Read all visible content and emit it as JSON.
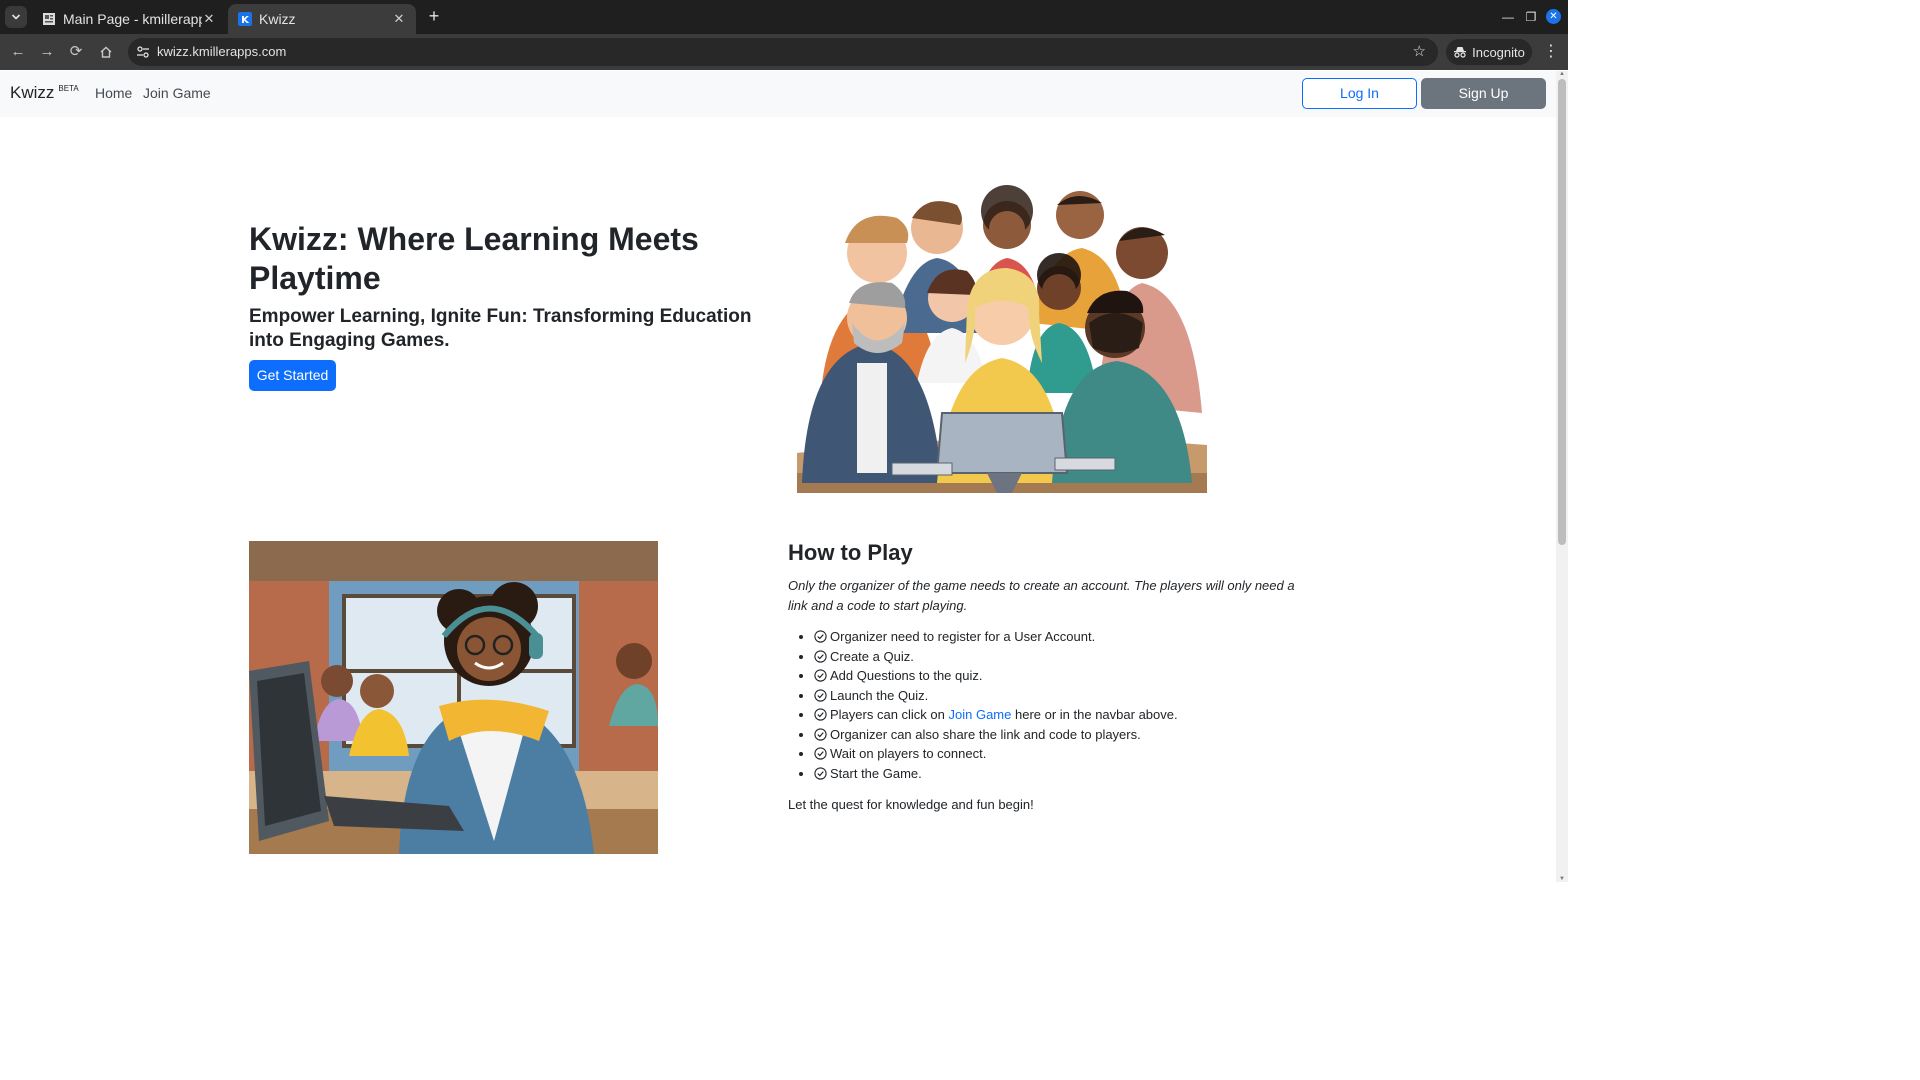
{
  "browser": {
    "tabs": [
      {
        "title": "Main Page - kmillerapps",
        "active": false
      },
      {
        "title": "Kwizz",
        "active": true
      }
    ],
    "url": "kwizz.kmillerapps.com",
    "incognito_label": "Incognito"
  },
  "navbar": {
    "brand": "Kwizz",
    "brand_badge": "BETA",
    "links": [
      "Home",
      "Join Game"
    ],
    "login_label": "Log In",
    "signup_label": "Sign Up"
  },
  "hero": {
    "title": "Kwizz: Where Learning Meets Playtime",
    "subtitle": "Empower Learning, Ignite Fun: Transforming Education into Engaging Games.",
    "cta_label": "Get Started"
  },
  "how_to": {
    "title": "How to Play",
    "intro": "Only the organizer of the game needs to create an account. The players will only need a link and a code to start playing.",
    "steps": [
      "Organizer need to register for a User Account.",
      "Create a Quiz.",
      "Add Questions to the quiz.",
      "Launch the Quiz.",
      {
        "before": "Players can click on ",
        "link": "Join Game",
        "after": " here or in the navbar above."
      },
      "Organizer can also share the link and code to players.",
      "Wait on players to connect.",
      "Start the Game."
    ],
    "closing": "Let the quest for knowledge and fun begin!"
  },
  "colors": {
    "primary": "#0d6efd",
    "secondary": "#6c757d",
    "navbar_bg": "#f8f9fa",
    "chrome_dark": "#1f1f1f"
  }
}
